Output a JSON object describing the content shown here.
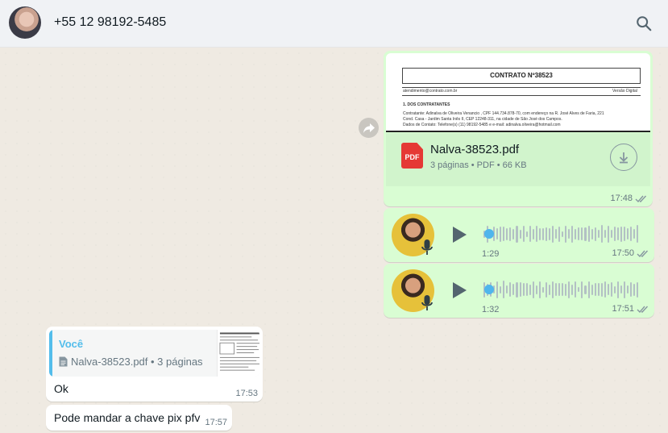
{
  "header": {
    "contact_name": "+55 12 98192-5485"
  },
  "document_message": {
    "preview_title": "CONTRATO Nº38523",
    "preview_email": "atendimento@contrato.com.br",
    "preview_right": "Versão Digital",
    "preview_section": "1. DOS CONTRATANTES",
    "preview_line1": "Contratante: Adinalva de Oliveira Venancio , CPF 144.734.878-70, com endereço na R. José Alves de Faria, 221",
    "preview_line2": "Cond. Casa - Jardim Santa Inês II, CEP 12248-311, na cidade de São José dos Campos.",
    "preview_line3": "Dados de Contato: Telefone(s) (11) 98192-5485 e e-mail: adinalva.oliveira@hotmail.com",
    "pdf_label": "PDF",
    "file_name": "Nalva-38523.pdf",
    "file_meta": "3 páginas • PDF • 66 KB",
    "time": "17:48"
  },
  "audio_messages": [
    {
      "duration": "1:29",
      "time": "17:50"
    },
    {
      "duration": "1:32",
      "time": "17:51"
    }
  ],
  "reply_message": {
    "quote_sender": "Você",
    "quote_file": "Nalva-38523.pdf • 3 páginas",
    "text": "Ok",
    "time": "17:53"
  },
  "last_message": {
    "text": "Pode mandar a chave pix pfv",
    "time": "17:57"
  },
  "colors": {
    "outgoing_bubble": "#d9fdd3",
    "incoming_bubble": "#ffffff",
    "accent_blue": "#53bdeb",
    "pdf_red": "#e53935"
  }
}
